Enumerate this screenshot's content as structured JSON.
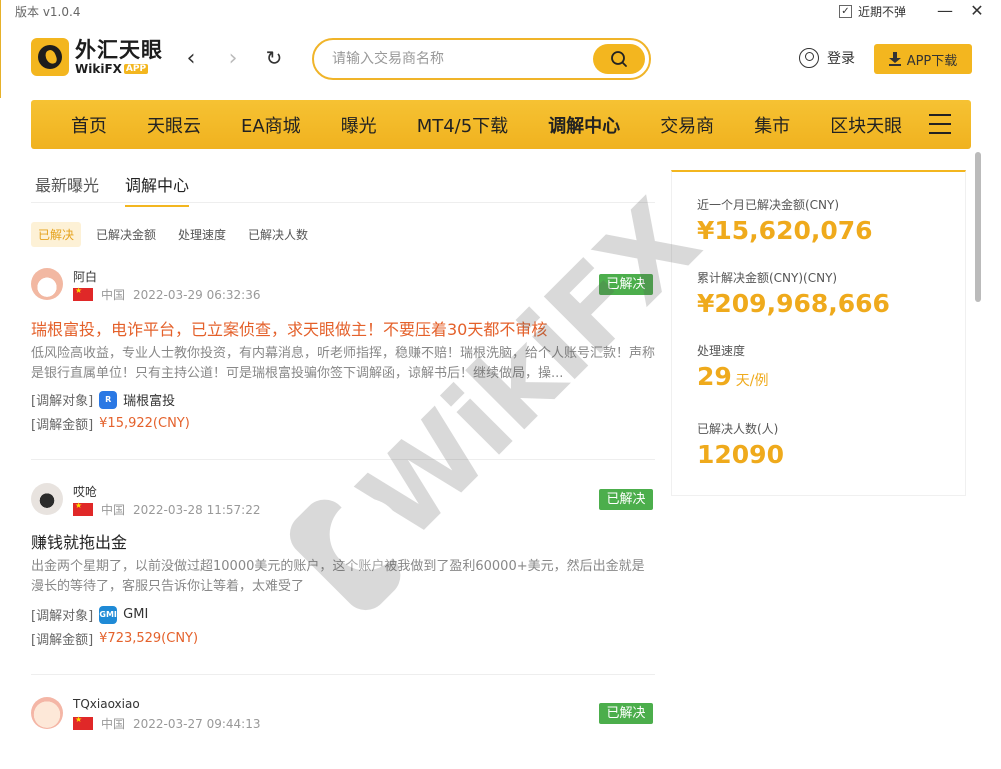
{
  "window": {
    "version": "版本 v1.0.4",
    "no_popup_label": "近期不弹",
    "no_popup_checked": true
  },
  "header": {
    "logo_cn": "外汇天眼",
    "logo_en": "WikiFX",
    "logo_badge": "APP",
    "search_placeholder": "请输入交易商名称",
    "login_label": "登录",
    "app_download_label": "APP下载"
  },
  "nav": {
    "items": [
      "首页",
      "天眼云",
      "EA商城",
      "曝光",
      "MT4/5下载",
      "调解中心",
      "交易商",
      "集市",
      "区块天眼"
    ],
    "active_index": 5
  },
  "tabs": {
    "items": [
      "最新曝光",
      "调解中心"
    ],
    "active_index": 1
  },
  "filters": {
    "items": [
      "已解决",
      "已解决金额",
      "处理速度",
      "已解决人数"
    ],
    "active_index": 0
  },
  "cases": [
    {
      "user": "阿白",
      "country": "中国",
      "time": "2022-03-29 06:32:36",
      "status": "已解决",
      "title": "瑞根富投，电诈平台，已立案侦查，求天眼做主！不要压着30天都不审核",
      "desc": "低风险高收益，专业人士教你投资，有内幕消息，听老师指挥，稳赚不赔！瑞根洗脑，给个人账号汇款！声称是银行直属单位！只有主持公道！可是瑞根富投骗你签下调解函，谅解书后！继续做局，操...",
      "target_label": "[调解对象]",
      "target_name": "瑞根富投",
      "amount_label": "[调解金额]",
      "amount": "¥15,922(CNY)"
    },
    {
      "user": "哎呛",
      "country": "中国",
      "time": "2022-03-28 11:57:22",
      "status": "已解决",
      "title": "赚钱就拖出金",
      "desc": "出金两个星期了，以前没做过超10000美元的账户，这个账户被我做到了盈利60000+美元，然后出金就是漫长的等待了，客服只告诉你让等着，太难受了",
      "target_label": "[调解对象]",
      "target_name": "GMI",
      "amount_label": "[调解金额]",
      "amount": "¥723,529(CNY)"
    },
    {
      "user": "TQxiaoxiao",
      "country": "中国",
      "time": "2022-03-27 09:44:13",
      "status": "已解决"
    }
  ],
  "stats": {
    "month_label": "近一个月已解决金额(CNY)",
    "month_value": "¥15,620,076",
    "total_label": "累计解决金额(CNY)(CNY)",
    "total_value": "¥209,968,666",
    "speed_label": "处理速度",
    "speed_value": "29",
    "speed_unit": "天/例",
    "people_label": "已解决人数(人)",
    "people_value": "12090"
  },
  "watermark": "WikiFX",
  "colors": {
    "brand": "#f3b61f",
    "accent_text": "#efaa1c",
    "hot_title": "#e4612b",
    "resolved_badge": "#4cae4c"
  }
}
